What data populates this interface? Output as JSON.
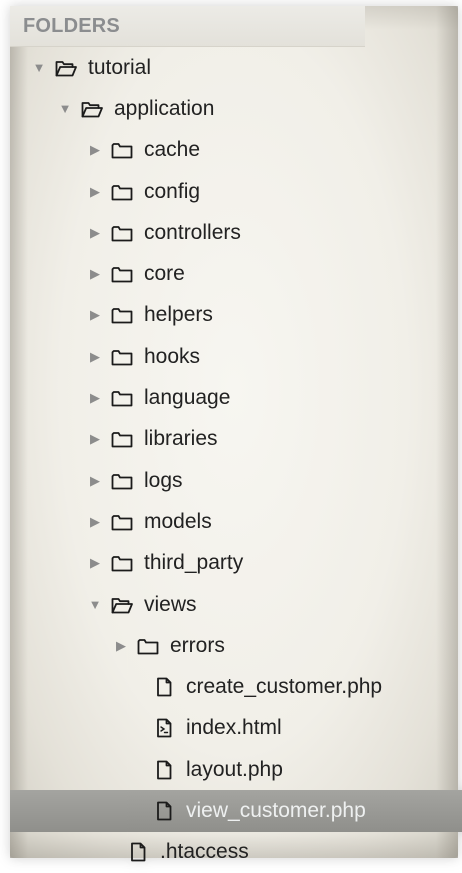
{
  "panel": {
    "title": "FOLDERS"
  },
  "tree": {
    "items": [
      {
        "label": "tutorial",
        "type": "folder",
        "expanded": true,
        "depth": 0,
        "icon": "folder-open-icon"
      },
      {
        "label": "application",
        "type": "folder",
        "expanded": true,
        "depth": 1,
        "icon": "folder-open-icon"
      },
      {
        "label": "cache",
        "type": "folder",
        "expanded": false,
        "depth": 2,
        "icon": "folder-icon"
      },
      {
        "label": "config",
        "type": "folder",
        "expanded": false,
        "depth": 2,
        "icon": "folder-icon"
      },
      {
        "label": "controllers",
        "type": "folder",
        "expanded": false,
        "depth": 2,
        "icon": "folder-icon"
      },
      {
        "label": "core",
        "type": "folder",
        "expanded": false,
        "depth": 2,
        "icon": "folder-icon"
      },
      {
        "label": "helpers",
        "type": "folder",
        "expanded": false,
        "depth": 2,
        "icon": "folder-icon"
      },
      {
        "label": "hooks",
        "type": "folder",
        "expanded": false,
        "depth": 2,
        "icon": "folder-icon"
      },
      {
        "label": "language",
        "type": "folder",
        "expanded": false,
        "depth": 2,
        "icon": "folder-icon"
      },
      {
        "label": "libraries",
        "type": "folder",
        "expanded": false,
        "depth": 2,
        "icon": "folder-icon"
      },
      {
        "label": "logs",
        "type": "folder",
        "expanded": false,
        "depth": 2,
        "icon": "folder-icon"
      },
      {
        "label": "models",
        "type": "folder",
        "expanded": false,
        "depth": 2,
        "icon": "folder-icon"
      },
      {
        "label": "third_party",
        "type": "folder",
        "expanded": false,
        "depth": 2,
        "icon": "folder-icon"
      },
      {
        "label": "views",
        "type": "folder",
        "expanded": true,
        "depth": 2,
        "icon": "folder-open-icon"
      },
      {
        "label": "errors",
        "type": "folder",
        "expanded": false,
        "depth": 3,
        "icon": "folder-icon"
      },
      {
        "label": "create_customer.php",
        "type": "file",
        "depth": 3,
        "icon": "file-icon"
      },
      {
        "label": "index.html",
        "type": "file",
        "depth": 3,
        "icon": "file-code-icon"
      },
      {
        "label": "layout.php",
        "type": "file",
        "depth": 3,
        "icon": "file-icon"
      },
      {
        "label": "view_customer.php",
        "type": "file",
        "depth": 3,
        "icon": "file-icon",
        "selected": true
      },
      {
        "label": ".htaccess",
        "type": "file",
        "depth": 2,
        "icon": "file-icon"
      }
    ]
  },
  "colors": {
    "selected_row": "#9a9a96",
    "title_text": "#8b8d8f",
    "label_text": "#222222",
    "arrow": "#8c8c8c"
  }
}
